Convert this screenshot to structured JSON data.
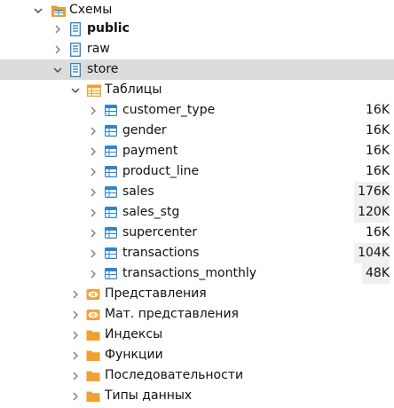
{
  "tree": {
    "schemas": {
      "label": "Схемы",
      "expanded": true,
      "children": [
        {
          "label": "public",
          "bold": true,
          "expanded": false
        },
        {
          "label": "raw",
          "bold": false,
          "expanded": false
        },
        {
          "label": "store",
          "bold": false,
          "expanded": true,
          "selected": true
        }
      ]
    },
    "tables": {
      "label": "Таблицы",
      "expanded": true,
      "items": [
        {
          "name": "customer_type",
          "size": "16K",
          "highlight": false
        },
        {
          "name": "gender",
          "size": "16K",
          "highlight": false
        },
        {
          "name": "payment",
          "size": "16K",
          "highlight": false
        },
        {
          "name": "product_line",
          "size": "16K",
          "highlight": false
        },
        {
          "name": "sales",
          "size": "176K",
          "highlight": true
        },
        {
          "name": "sales_stg",
          "size": "120K",
          "highlight": true
        },
        {
          "name": "supercenter",
          "size": "16K",
          "highlight": false
        },
        {
          "name": "transactions",
          "size": "104K",
          "highlight": true
        },
        {
          "name": "transactions_monthly",
          "size": "48K",
          "highlight": true
        }
      ]
    },
    "folders": [
      {
        "label": "Представления",
        "icon": "view-icon"
      },
      {
        "label": "Мат. представления",
        "icon": "view-icon"
      },
      {
        "label": "Индексы",
        "icon": "folder-icon"
      },
      {
        "label": "Функции",
        "icon": "folder-icon"
      },
      {
        "label": "Последовательности",
        "icon": "folder-icon"
      },
      {
        "label": "Типы данных",
        "icon": "folder-icon"
      }
    ]
  },
  "colors": {
    "selection": "#dcdcdc",
    "size_highlight": "#f0f0f0",
    "schema_icon": "#2e7fc0",
    "table_icon": "#2f86cc",
    "folder_icon": "#f0a030",
    "view_icon": "#f3a23a"
  }
}
